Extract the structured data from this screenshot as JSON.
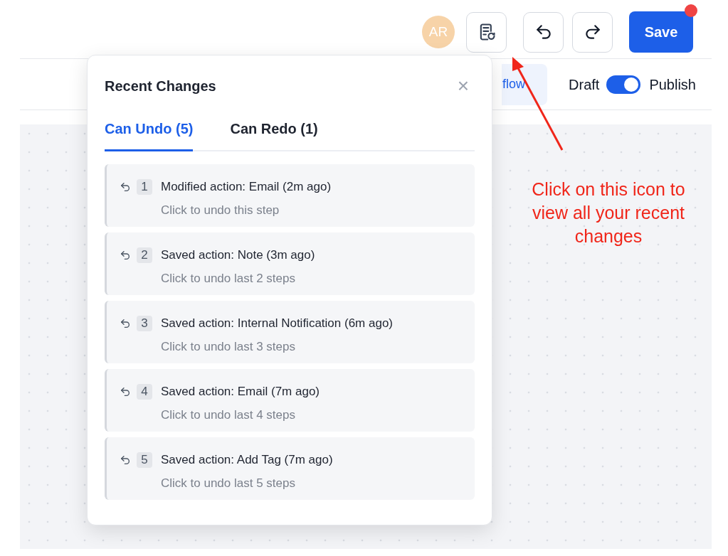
{
  "topbar": {
    "avatar": "AR",
    "save_button": "Save",
    "save_badge": true
  },
  "toolbar": {
    "tab": "flow",
    "toggle": {
      "left_label": "Draft",
      "right_label": "Publish",
      "on": true
    }
  },
  "popup": {
    "title": "Recent Changes",
    "close": "×",
    "tabs": [
      {
        "label": "Can Undo (5)",
        "selected": true
      },
      {
        "label": "Can Redo (1)",
        "selected": false
      }
    ],
    "items": [
      {
        "number": "1",
        "title": "Modified action: Email (2m ago)",
        "subtitle": "Click to undo this step"
      },
      {
        "number": "2",
        "title": "Saved action: Note (3m ago)",
        "subtitle": "Click to undo last 2 steps"
      },
      {
        "number": "3",
        "title": "Saved action: Internal Notification (6m ago)",
        "subtitle": "Click to undo last 3 steps"
      },
      {
        "number": "4",
        "title": "Saved action: Email (7m ago)",
        "subtitle": "Click to undo last 4 steps"
      },
      {
        "number": "5",
        "title": "Saved action: Add Tag (7m ago)",
        "subtitle": "Click to undo last 5 steps"
      }
    ]
  },
  "annotation": {
    "text": "Click on this icon to view all your recent changes"
  }
}
